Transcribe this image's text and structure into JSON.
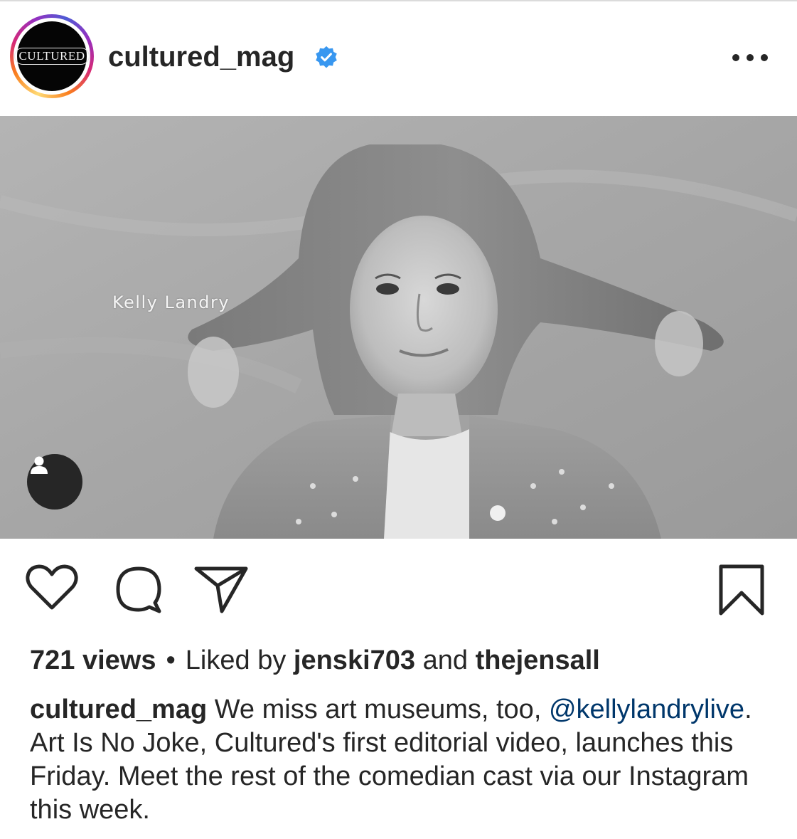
{
  "post": {
    "username": "cultured_mag",
    "avatar_logo_text": "CULTURED",
    "verified": true,
    "more_icon": "more-horizontal-icon",
    "media": {
      "overlay_name": "Kelly Landry",
      "tag_icon": "person-icon"
    },
    "actions": {
      "like_icon": "heart-icon",
      "comment_icon": "comment-icon",
      "share_icon": "send-icon",
      "save_icon": "bookmark-icon"
    },
    "stats": {
      "views": "721 views",
      "separator": "•",
      "liked_by_prefix": "Liked by",
      "liker_1": "jenski703",
      "conjunction": "and",
      "liker_2": "thejensall"
    },
    "caption": {
      "author": "cultured_mag",
      "text_1": "We miss art museums, too,",
      "mention": "@kellylandrylive",
      "text_2": ". Art Is No Joke, Cultured's first editorial video, launches this Friday. Meet the rest of the comedian cast via our Instagram this week."
    },
    "colors": {
      "verified_badge": "#3897f0",
      "mention": "#00376b",
      "text": "#262626"
    }
  }
}
